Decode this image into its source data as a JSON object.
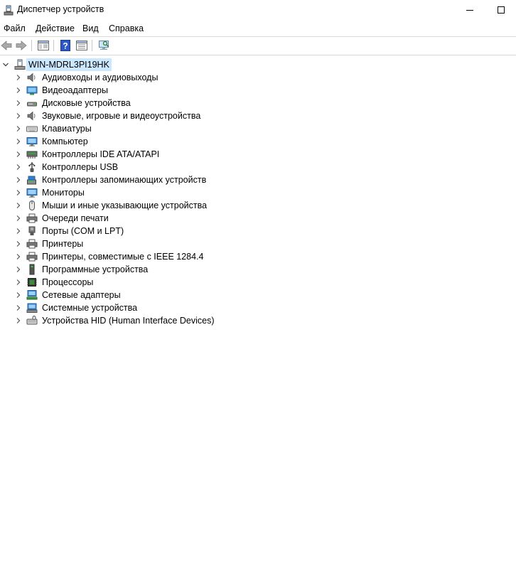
{
  "window": {
    "title": "Диспетчер устройств"
  },
  "menu": {
    "items": [
      "Файл",
      "Действие",
      "Вид",
      "Справка"
    ]
  },
  "toolbar": {
    "buttons": [
      "back-icon",
      "forward-icon",
      "show-hide-console-tree-icon",
      "help-icon",
      "properties-icon",
      "scan-hardware-icon"
    ]
  },
  "tree": {
    "root": "WIN-MDRL3PI19HK",
    "categories": [
      {
        "label": "Аудиовходы и аудиовыходы",
        "icon": "speaker-icon"
      },
      {
        "label": "Видеоадаптеры",
        "icon": "display-adapter-icon"
      },
      {
        "label": "Дисковые устройства",
        "icon": "disk-drive-icon"
      },
      {
        "label": "Звуковые, игровые и видеоустройства",
        "icon": "speaker-icon"
      },
      {
        "label": "Клавиатуры",
        "icon": "keyboard-icon"
      },
      {
        "label": "Компьютер",
        "icon": "computer-icon"
      },
      {
        "label": "Контроллеры IDE ATA/ATAPI",
        "icon": "ide-controller-icon"
      },
      {
        "label": "Контроллеры USB",
        "icon": "usb-icon"
      },
      {
        "label": "Контроллеры запоминающих устройств",
        "icon": "storage-controller-icon"
      },
      {
        "label": "Мониторы",
        "icon": "monitor-icon"
      },
      {
        "label": "Мыши и иные указывающие устройства",
        "icon": "mouse-icon"
      },
      {
        "label": "Очереди печати",
        "icon": "print-queue-icon"
      },
      {
        "label": "Порты (COM и LPT)",
        "icon": "port-icon"
      },
      {
        "label": "Принтеры",
        "icon": "printer-icon"
      },
      {
        "label": "Принтеры, совместимые с IEEE 1284.4",
        "icon": "printer-icon"
      },
      {
        "label": "Программные устройства",
        "icon": "software-device-icon"
      },
      {
        "label": "Процессоры",
        "icon": "processor-icon"
      },
      {
        "label": "Сетевые адаптеры",
        "icon": "network-adapter-icon"
      },
      {
        "label": "Системные устройства",
        "icon": "system-device-icon"
      },
      {
        "label": "Устройства HID (Human Interface Devices)",
        "icon": "hid-icon"
      }
    ]
  },
  "colors": {
    "selection": "#cce8ff",
    "accent": "#1e6fd1"
  }
}
